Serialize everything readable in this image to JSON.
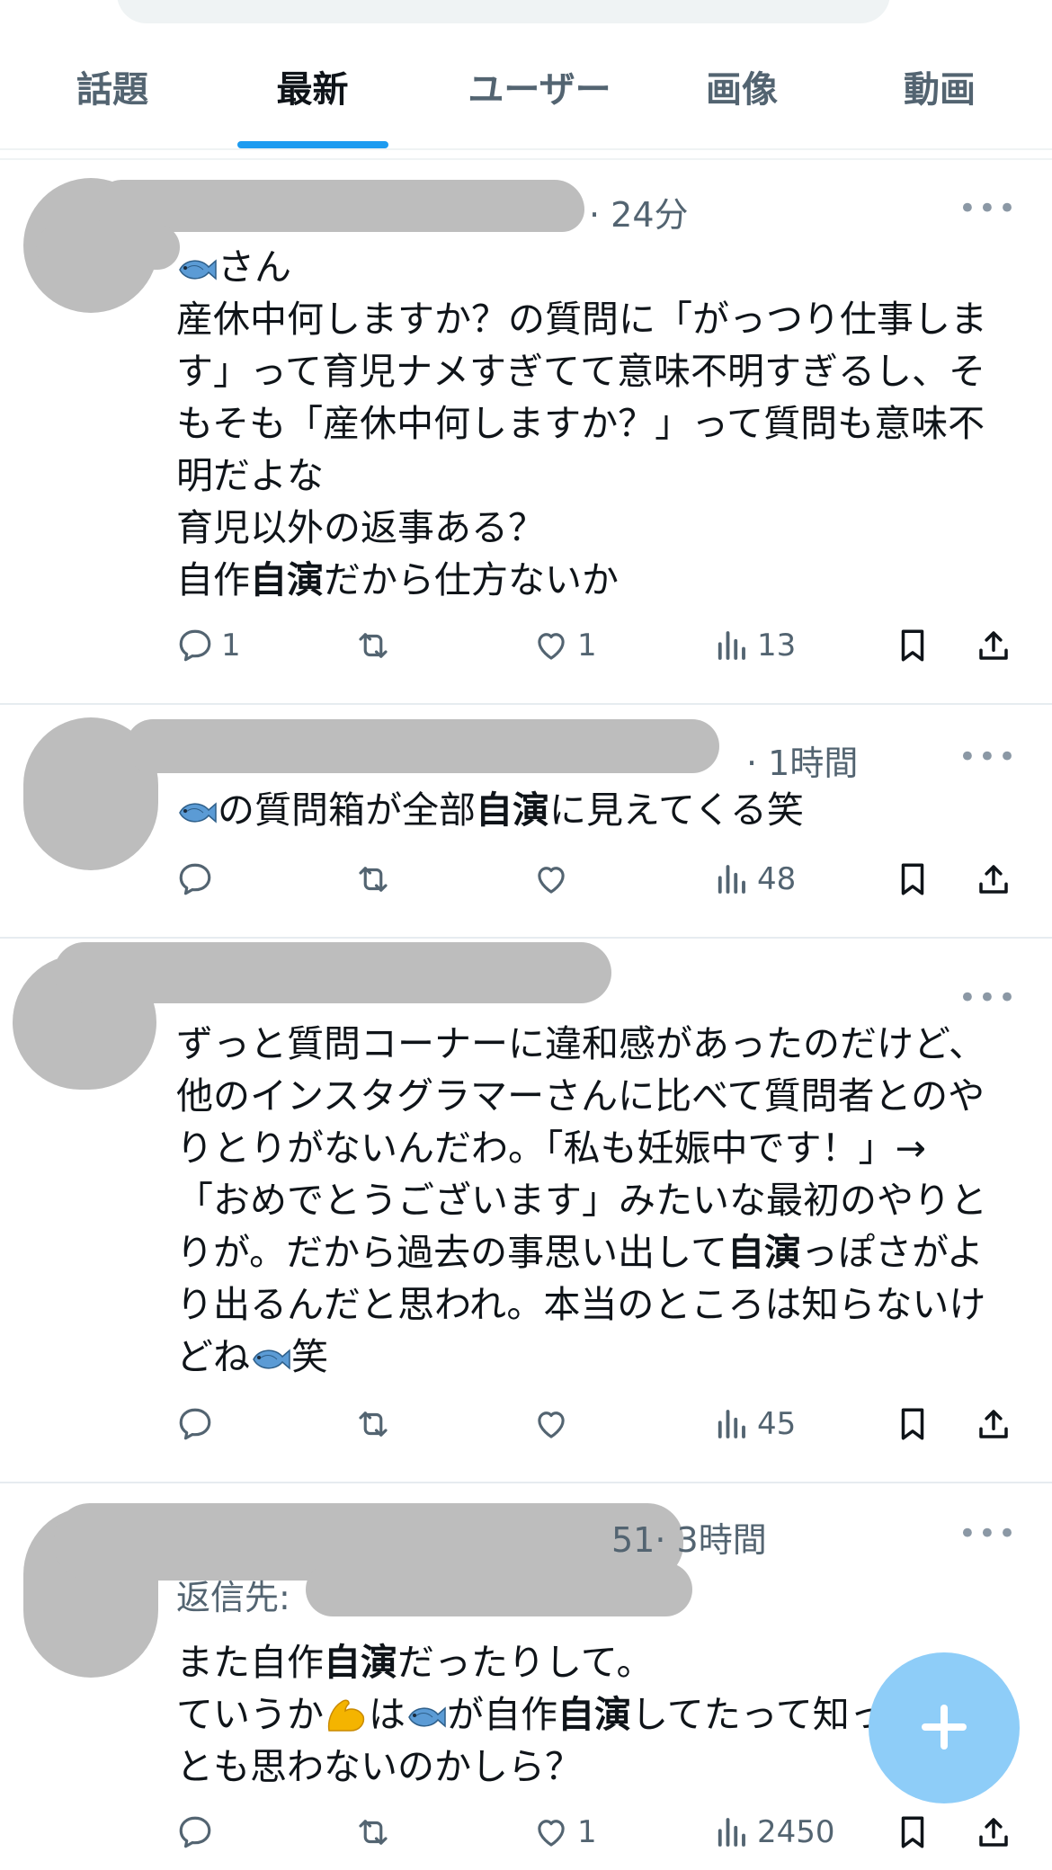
{
  "tabs": [
    "話題",
    "最新",
    "ユーザー",
    "画像",
    "動画"
  ],
  "active_tab": "最新",
  "colors": {
    "accent": "#1d9bf0",
    "muted": "#536471",
    "fab": "#8ecdf8"
  },
  "tweets": [
    {
      "time": "· 24分",
      "line1_after_fish": "さん",
      "text_lines": [
        "産休中何しますか？の質問に「がっつり仕事しま",
        "す」って育児ナメすぎてて意味不明すぎるし、そ",
        "もそも「産休中何しますか？」って質問も意味不",
        "明だよな",
        "育児以外の返事ある？"
      ],
      "last_pre": "自作",
      "last_bold": "自演",
      "last_post": "だから仕方ないか",
      "replies": "1",
      "likes": "1",
      "views": "13"
    },
    {
      "time": "· 1時間",
      "pre": "の質問箱が全部",
      "bold": "自演",
      "post": "に見えてくる笑",
      "replies": "",
      "likes": "",
      "views": "48"
    },
    {
      "lines": [
        "ずっと質問コーナーに違和感があったのだけど、",
        "他のインスタグラマーさんに比べて質問者とのや",
        "りとりがないんだわ。「私も妊娠中です！」→",
        "「おめでとうございます」みたいな最初のやりと"
      ],
      "line5_pre": "りが。だから過去の事思い出して",
      "line5_bold": "自演",
      "line5_post": "っぽさがよ",
      "line6": "り出るんだと思われ。本当のところは知らないけ",
      "line7_pre": "どね",
      "line7_post": "笑",
      "replies": "",
      "likes": "",
      "views": "45"
    },
    {
      "time": "· 3時間",
      "time_prefix_fragment": "51",
      "reply_label": "返信先:",
      "l1_pre": "また自作",
      "l1_bold": "自演",
      "l1_post": "だったりして。",
      "l2_a": "ていうか",
      "l2_b": "は",
      "l2_c": "が自作",
      "l2_bold": "自演",
      "l2_d": "してたって知って何",
      "l3": "とも思わないのかしら？",
      "replies": "",
      "likes": "1",
      "views": "2450"
    }
  ],
  "icons": [
    "reply-icon",
    "retweet-icon",
    "like-icon",
    "views-icon",
    "bookmark-icon",
    "share-icon",
    "more-icon",
    "fish-emoji-icon",
    "flexed-biceps-emoji-icon",
    "compose-plus-icon"
  ]
}
